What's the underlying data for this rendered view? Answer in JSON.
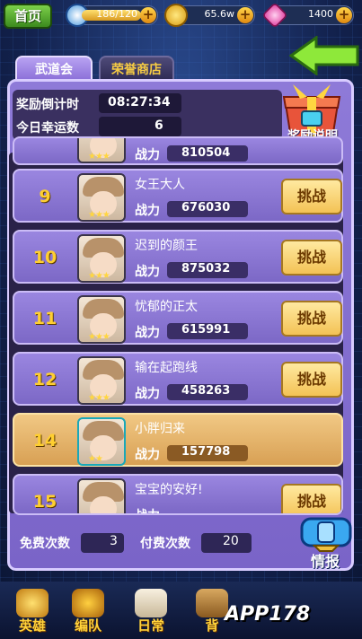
{
  "topbar": {
    "home_label": "首页",
    "stamina": "186/120",
    "gold": "65.6w",
    "gems": "1400"
  },
  "tabs": [
    {
      "label": "武道会"
    },
    {
      "label": "荣誉商店"
    }
  ],
  "info": {
    "countdown_label": "奖励倒计时",
    "countdown_value": "08:27:34",
    "lucky_label": "今日幸运数",
    "lucky_value": "6",
    "reward_info_label": "奖励说明"
  },
  "rows": [
    {
      "rank": "",
      "name": "",
      "power_label": "战力",
      "power": "810504",
      "button": "",
      "stars": "★★★"
    },
    {
      "rank": "9",
      "name": "女王大人",
      "power_label": "战力",
      "power": "676030",
      "button": "挑战",
      "stars": "★★★"
    },
    {
      "rank": "10",
      "name": "迟到的颜王",
      "power_label": "战力",
      "power": "875032",
      "button": "挑战",
      "stars": "★★★"
    },
    {
      "rank": "11",
      "name": "忧郁的正太",
      "power_label": "战力",
      "power": "615991",
      "button": "挑战",
      "stars": "★★★"
    },
    {
      "rank": "12",
      "name": "输在起跑线",
      "power_label": "战力",
      "power": "458263",
      "button": "挑战",
      "stars": "★★★"
    },
    {
      "rank": "14",
      "name": "小胖归来",
      "power_label": "战力",
      "power": "157798",
      "button": "",
      "stars": "★★"
    },
    {
      "rank": "15",
      "name": "宝宝的安好!",
      "power_label": "战力",
      "power": "",
      "button": "挑战",
      "stars": "★★★"
    }
  ],
  "counts": {
    "free_label": "免费次数",
    "free_value": "3",
    "paid_label": "付费次数",
    "paid_value": "20"
  },
  "intel_label": "情报",
  "bottom_nav": [
    {
      "label": "英雄"
    },
    {
      "label": "编队"
    },
    {
      "label": "日常"
    },
    {
      "label": "背"
    }
  ],
  "watermark": "APP178"
}
